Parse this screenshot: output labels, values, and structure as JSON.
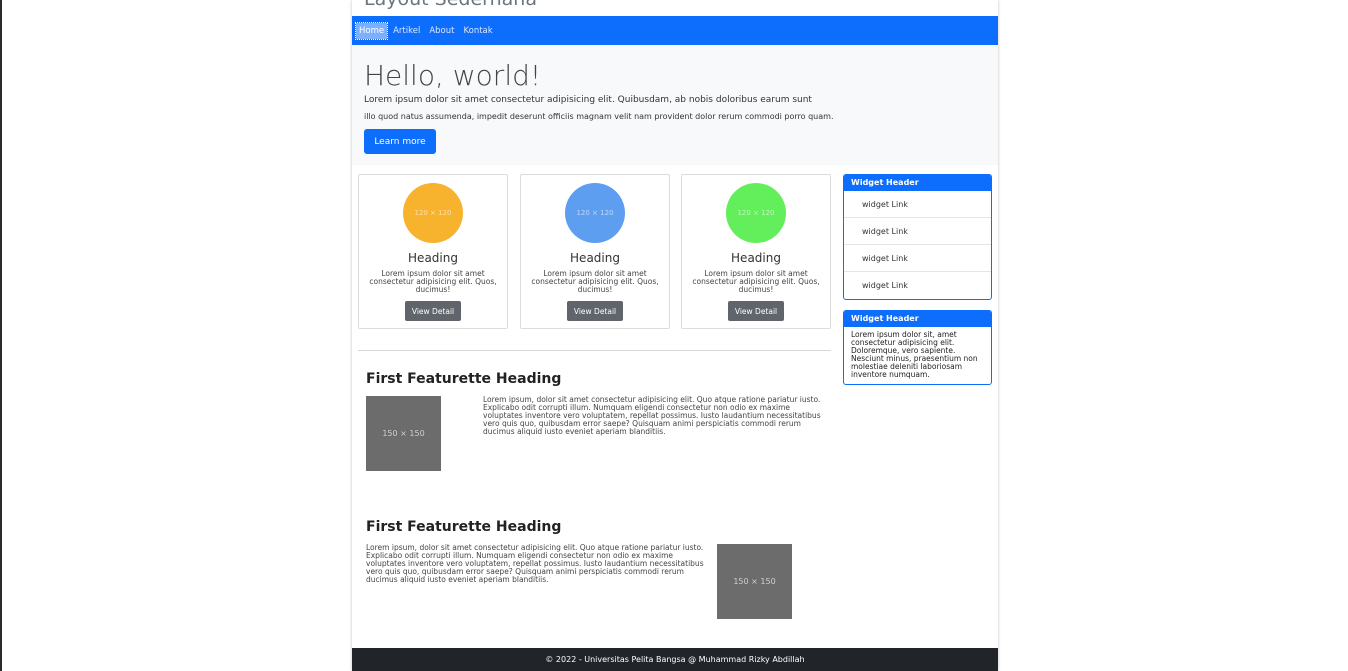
{
  "site": {
    "title": "Layout Sederhana"
  },
  "nav": {
    "items": [
      "Home",
      "Artikel",
      "About",
      "Kontak"
    ]
  },
  "jumbotron": {
    "title": "Hello, world!",
    "text_line1": "Lorem ipsum dolor sit amet consectetur adipisicing elit. Quibusdam, ab nobis doloribus earum sunt",
    "text_line2": "illo quod natus assumenda, impedit deserunt officiis magnam velit nam provident dolor rerum commodi porro quam.",
    "button": "Learn more"
  },
  "cards": [
    {
      "placeholder": "120 × 120",
      "heading": "Heading",
      "text": "Lorem ipsum dolor sit amet consectetur adipisicing elit. Quos, ducimus!",
      "button": "View Detail",
      "color": "#f7b22e"
    },
    {
      "placeholder": "120 × 120",
      "heading": "Heading",
      "text": "Lorem ipsum dolor sit amet consectetur adipisicing elit. Quos, ducimus!",
      "button": "View Detail",
      "color": "#5e9ef0"
    },
    {
      "placeholder": "120 × 120",
      "heading": "Heading",
      "text": "Lorem ipsum dolor sit amet consectetur adipisicing elit. Quos, ducimus!",
      "button": "View Detail",
      "color": "#63ee5c"
    }
  ],
  "widgets": [
    {
      "header": "Widget Header",
      "links": [
        "widget Link",
        "widget Link",
        "widget Link",
        "widget Link"
      ]
    },
    {
      "header": "Widget Header",
      "body": "Lorem ipsum dolor sit, amet consectetur adipisicing elit. Doloremque, vero sapiente. Nesciunt minus, praesentium non molestiae deleniti laboriosam inventore numquam."
    }
  ],
  "features": [
    {
      "heading": "First Featurette Heading",
      "image": "150 × 150",
      "text": "Lorem ipsum, dolor sit amet consectetur adipisicing elit. Quo atque ratione pariatur iusto. Explicabo odit corrupti illum. Numquam eligendi consectetur non odio ex maxime voluptates inventore vero voluptatem, repellat possimus. Iusto laudantium necessitatibus vero quis quo, quibusdam error saepe? Quisquam animi perspiciatis commodi rerum ducimus aliquid iusto eveniet aperiam blanditiis."
    },
    {
      "heading": "First Featurette Heading",
      "image": "150 × 150",
      "text": "Lorem ipsum, dolor sit amet consectetur adipisicing elit. Quo atque ratione pariatur iusto. Explicabo odit corrupti illum. Numquam eligendi consectetur non odio ex maxime voluptates inventore vero voluptatem, repellat possimus. Iusto laudantium necessitatibus vero quis quo, quibusdam error saepe? Quisquam animi perspiciatis commodi rerum ducimus aliquid iusto eveniet aperiam blanditiis."
    }
  ],
  "footer": {
    "text": "© 2022 - Universitas Pelita Bangsa @ Muhammad Rizky Abdillah"
  },
  "colors": {
    "primary": "#0d6efd",
    "secondary_button": "#5f656b",
    "footer_bg": "#212529",
    "jumbotron_bg": "#f8f9fa"
  }
}
